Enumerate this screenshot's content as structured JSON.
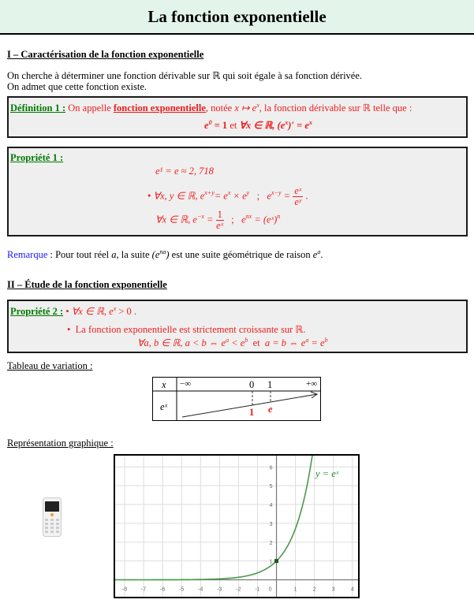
{
  "header": {
    "title": "La fonction exponentielle"
  },
  "section1": {
    "heading": "I – Caractérisation de la fonction exponentielle",
    "intro_line1_a": "On cherche à déterminer une fonction dérivable sur",
    "intro_line1_R": "ℝ",
    "intro_line1_b": "qui soit égale à sa fonction dérivée.",
    "intro_line2": "On admet que cette fonction existe.",
    "definition": {
      "label": "Définition 1 :",
      "text_a": "On appelle",
      "term": "fonction exponentielle",
      "text_b": ", notée",
      "notation": "x ↦ e",
      "notation_exp": "x",
      "text_c": ", la fonction dérivable sur",
      "R": "ℝ",
      "text_d": "telle que :",
      "formula_a": "e",
      "formula_a_exp": "0",
      "formula_b": " = 1 ",
      "formula_et": "et",
      "formula_c": " ∀x ∈ ℝ, (e",
      "formula_c_exp": "x",
      "formula_d": ")′ = e",
      "formula_d_exp": "x"
    },
    "property1": {
      "label": "Propriété 1 :",
      "line1": "e¹ = e ≈ 2, 718",
      "bullet": "•",
      "line2_a": "∀x, y ∈ ℝ, e",
      "line2_a_exp": "x+y",
      "line2_b": "= e",
      "line2_b_exp": "x",
      "line2_c": " × e",
      "line2_c_exp": "y",
      "line2_sep": ";",
      "line2_d": "e",
      "line2_d_exp": "x−y",
      "line2_e": " =",
      "line2_frac_num": "eˣ",
      "line2_frac_den": "eʸ",
      "line2_end": ".",
      "line3_a": "∀x ∈ ℝ, e",
      "line3_a_exp": "−x",
      "line3_b": " =",
      "line3_frac_num": "1",
      "line3_frac_den": "eˣ",
      "line3_sep": ";",
      "line3_c": "e",
      "line3_c_exp": "nx",
      "line3_d": " = (eˣ)",
      "line3_d_exp": "n"
    },
    "remark": {
      "label": "Remarque",
      "text_a": " : Pour tout réel",
      "var_a": " a",
      "text_b": ", la suite",
      "sequence": "(e",
      "sequence_exp": "na",
      "sequence_close": ")",
      "text_c": "est une suite géométrique de raison",
      "ratio": "e",
      "ratio_exp": "a",
      "end": "."
    }
  },
  "section2": {
    "heading": "II – Étude de la fonction exponentielle",
    "property2": {
      "label": "Propriété 2 :",
      "bullet": "•",
      "line1_a": "∀x ∈ ℝ, e",
      "line1_a_exp": "x",
      "line1_b": " > 0 .",
      "line2": "La fonction exponentielle est strictement croissante sur ℝ.",
      "line3_a": "∀a, b ∈ ℝ, a < b ⇔ e",
      "line3_a_exp": "a",
      "line3_b": " < e",
      "line3_b_exp": "b",
      "line3_et": "et",
      "line3_c": "a = b ⇔ e",
      "line3_c_exp": "a",
      "line3_d": " = e",
      "line3_d_exp": "b"
    },
    "variation_table": {
      "label": "Tableau de variation :",
      "row1_header": "x",
      "row2_header": "eˣ",
      "x_values": [
        "−∞",
        "0",
        "1",
        "+∞"
      ],
      "marks": [
        "1",
        "e"
      ],
      "direction": "increasing"
    },
    "graph": {
      "label": "Représentation graphique :",
      "curve_label": "y = eˣ",
      "curve_color": "#4a9a4a",
      "x_ticks": [
        "-8",
        "-7",
        "-6",
        "-5",
        "-4",
        "-3",
        "-2",
        "-1",
        "0",
        "1",
        "2",
        "3",
        "4"
      ],
      "y_ticks": [
        "1",
        "2",
        "3",
        "4",
        "5",
        "6"
      ],
      "x_range": [
        -8.5,
        4.3
      ],
      "y_range": [
        -0.9,
        6.6
      ],
      "point": [
        0,
        1
      ]
    }
  }
}
